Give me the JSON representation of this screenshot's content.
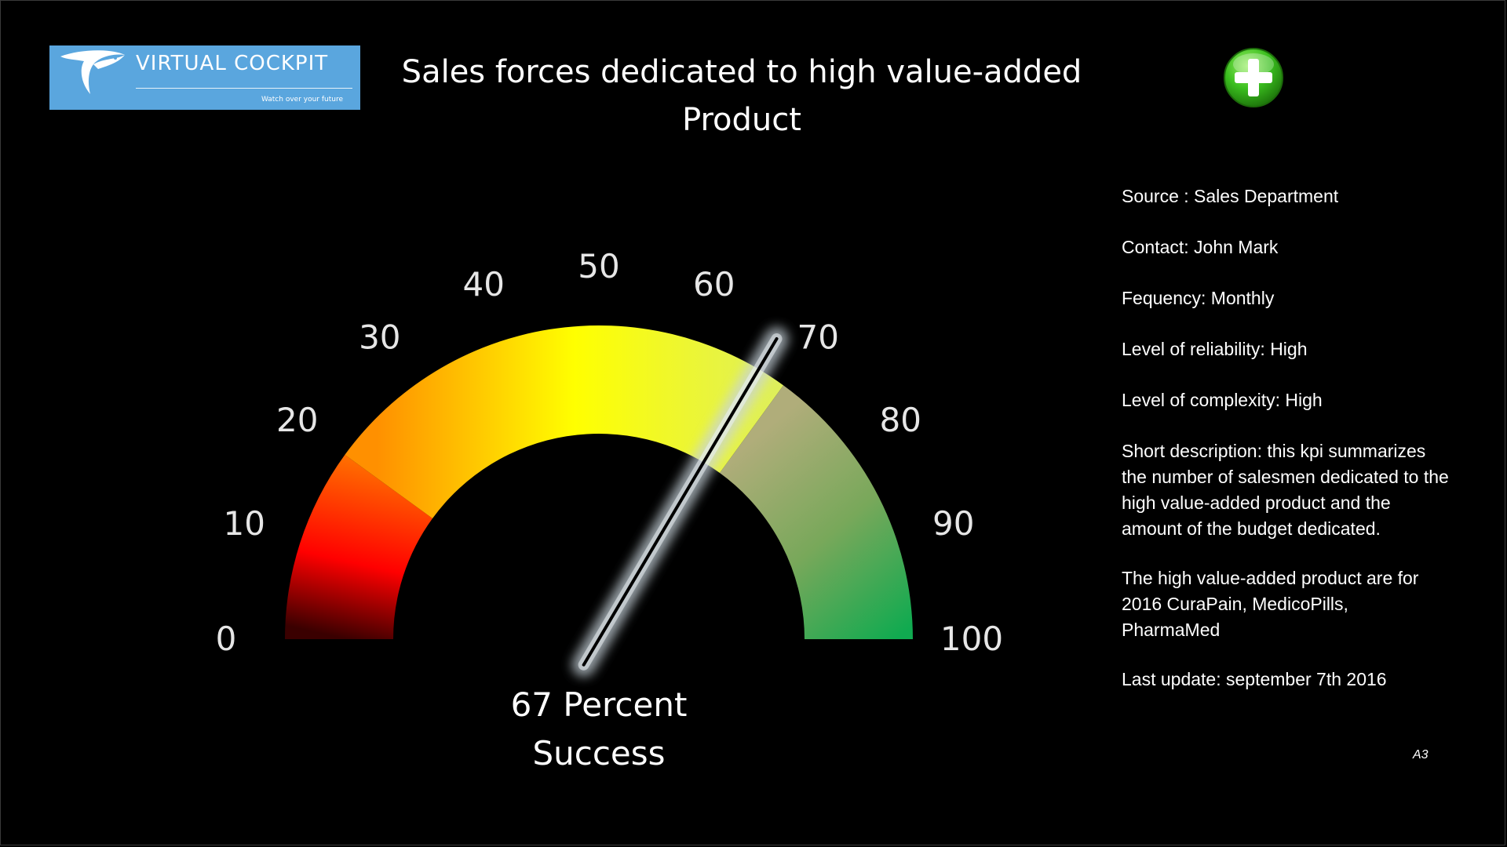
{
  "logo": {
    "name": "VIRTUAL COCKPIT",
    "tagline": "Watch over your future",
    "color": "#5aa6de"
  },
  "header": {
    "title": "Sales forces dedicated to high value-added Product"
  },
  "toolbar": {
    "add_icon": "plus-circle-icon",
    "add_color": "#3bbf1f"
  },
  "chart_data": {
    "type": "gauge",
    "title": "Sales forces dedicated to high value-added Product",
    "value": 67,
    "min": 0,
    "max": 100,
    "tick_labels": [
      "0",
      "10",
      "20",
      "30",
      "40",
      "50",
      "60",
      "70",
      "80",
      "90",
      "100"
    ],
    "bands": [
      {
        "from": 0,
        "to": 20,
        "color_start": "#4a0000",
        "color_end": "#ff9c00"
      },
      {
        "from": 20,
        "to": 70,
        "color_start": "#ff9c00",
        "color_mid": "#ffff00",
        "color_end": "#e0ee60"
      },
      {
        "from": 70,
        "to": 100,
        "color_start": "#a0a060",
        "color_end": "#10aa50"
      }
    ],
    "caption_line1": "67 Percent",
    "caption_line2": "Success"
  },
  "info": {
    "source": "Source : Sales Department",
    "contact": "Contact: John Mark",
    "frequency": "Fequency: Monthly",
    "reliability": "Level of reliability: High",
    "complexity": "Level of complexity: High",
    "description": "Short description: this kpi summarizes the number of salesmen dedicated to the high value-added product and the amount of the budget dedicated.",
    "products": "The high value-added product are for 2016   CuraPain, MedicoPills, PharmaMed",
    "last_update": "Last update:  september 7th 2016"
  },
  "page": {
    "id": "A3"
  }
}
